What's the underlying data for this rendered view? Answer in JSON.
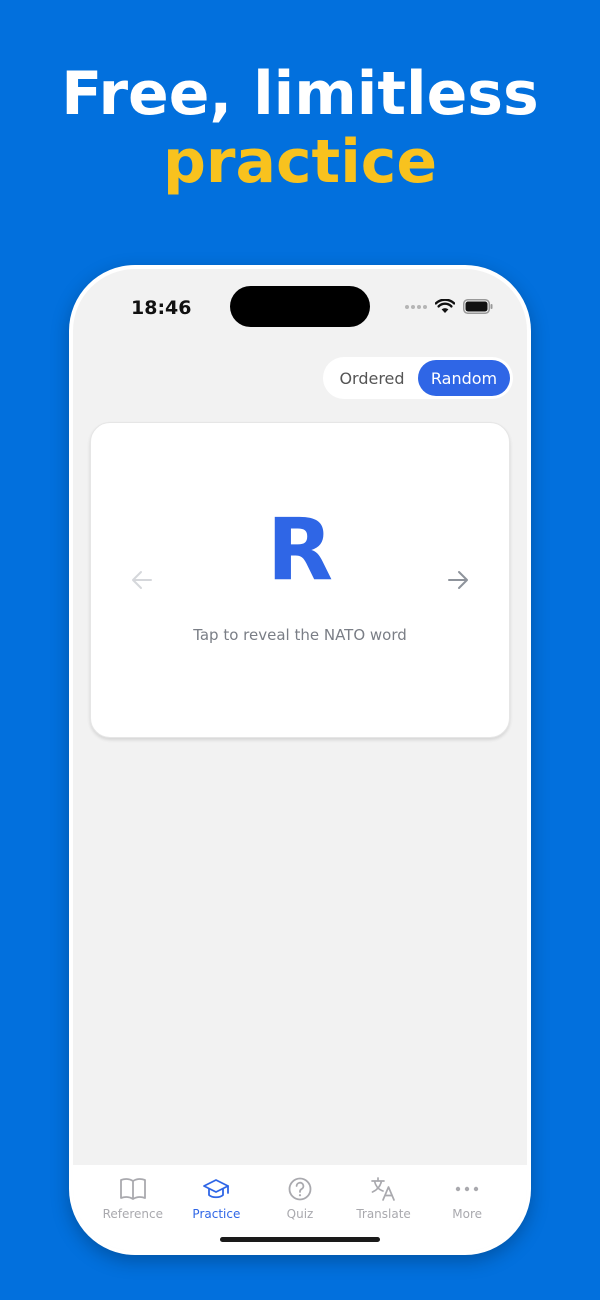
{
  "headline": {
    "line1": "Free, limitless",
    "line2": "practice"
  },
  "status": {
    "time": "18:46"
  },
  "mode_toggle": {
    "options": [
      "Ordered",
      "Random"
    ],
    "selected": "Random"
  },
  "card": {
    "letter": "R",
    "hint": "Tap to reveal the NATO word"
  },
  "tabs": [
    {
      "label": "Reference",
      "icon": "book-icon"
    },
    {
      "label": "Practice",
      "icon": "graduation-cap-icon"
    },
    {
      "label": "Quiz",
      "icon": "question-circle-icon"
    },
    {
      "label": "Translate",
      "icon": "translate-icon"
    },
    {
      "label": "More",
      "icon": "more-dots-icon"
    }
  ],
  "active_tab": "Practice",
  "colors": {
    "background": "#0270DD",
    "headline_accent": "#F8C21E",
    "primary": "#2F66E6",
    "inactive": "#A9A9AE"
  }
}
